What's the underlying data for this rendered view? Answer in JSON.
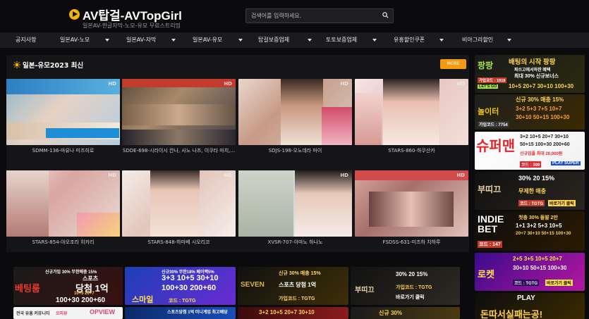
{
  "header": {
    "logo_text": "AV탑걸-AVTopGirl",
    "tagline": "일본AV-한글자막-노모-유모 무료스트리밍",
    "search_placeholder": "검색어를 입력하세요."
  },
  "nav": {
    "items": [
      "공지사항",
      "일본AV-노모",
      "일본AV-자막",
      "일본AV-유모",
      "탑걸보증업체",
      "토토보증업체",
      "유흥할인쿠폰",
      "비아그라할인"
    ]
  },
  "section": {
    "title": "일본-유모2023 최신",
    "more_label": "MORE"
  },
  "videos": [
    {
      "caption": "SDMM-136-마유나 미즈히로",
      "hd": "HD"
    },
    {
      "caption": "SDDE-698-시라이시 칸나, 사노 나츠, 이쿠타 마치,...",
      "hd": "HD"
    },
    {
      "caption": "SDJS-198-오노데라 마이",
      "hd": "HD"
    },
    {
      "caption": "STARS-860-하쿠산카",
      "hd": "HD"
    },
    {
      "caption": "STARS-854-야오조라 히카리",
      "hd": "HD"
    },
    {
      "caption": "STARS-848-하마베 시오리코",
      "hd": "HD"
    },
    {
      "caption": "XVSR-707-아마노 하나노",
      "hd": "HD"
    },
    {
      "caption": "FSDSS-631-미즈하 치하루",
      "hd": "HD"
    }
  ],
  "bottom_ads": [
    {
      "line1": "신규가입 30% 무한매충 15%",
      "line2": "스포츠",
      "line3": "당첨 1억",
      "line4": "10+5 20+7",
      "line5": "100+30 200+60",
      "brand": "베팅룸"
    },
    {
      "line1": "신규30% 무한18% 페이백5%",
      "line2": "3+3 10+5 30+10",
      "line3": "100+30 200+60",
      "line4": "코드 : TGTG",
      "brand": "스마일"
    },
    {
      "line1": "신규 30% 매충 15%",
      "line2": "스포츠 당첨 1억",
      "line3": "가입코드 : TGTG",
      "brand": "SEVEN"
    },
    {
      "line1": "30% 20 15%",
      "line2": "가입코드 : TGTG",
      "line3": "바로가기 클릭",
      "brand": "부띠끄"
    },
    {
      "line1": "전국 유흥 커뮤니티",
      "line2": "오피뷰",
      "brand": "OPVIEW"
    },
    {
      "line1": "스포츠당첨 1억 미니게임 최고배당",
      "brand": ""
    },
    {
      "line1": "3+2 10+5 20+7 30+10",
      "brand": ""
    },
    {
      "line1": "신규 30%",
      "brand": ""
    }
  ],
  "side_ads": [
    {
      "top": "배팅의 시작 팡팡",
      "mid": "파쓰고에서하한 혜택",
      "line": "최대 30% 신규보너스",
      "line2": "10+5 20+7 30+10 100+30",
      "code": "가입코드 : 1919",
      "brand": "팡팡",
      "go": "LET'S GO"
    },
    {
      "top": "신규 30% 매충 15%",
      "line": "3+2 5+3 7+5 10+7",
      "line2": "30+10 50+15 100+30",
      "code": "가입코드 : 7754",
      "brand": "놀이터"
    },
    {
      "top": "3+2 10+5 20+7 30+10",
      "line": "50+15 100+30 200+60",
      "line2": "신규입플 최대 20,000원",
      "code": "코드 : 399",
      "brand": "슈퍼맨",
      "go": "PLAY SUPER"
    },
    {
      "top": "30% 20 15%",
      "line": "무제한 매충",
      "code": "코드 : TGTG",
      "brand": "부띠끄",
      "go": "바로가기 클릭"
    },
    {
      "top": "첫충 30% 돌발 2만",
      "line": "1+1 3+2 5+3 10+5",
      "line2": "20+7 30+10 50+15 100+30",
      "code": "코드 : 147",
      "brand": "INDIE BET"
    },
    {
      "top": "2+5 3+5 10+5 20+7",
      "line": "30+10 50+15 100+30",
      "code": "코드 : TGTG",
      "brand": "로켓",
      "go": "바로가기 클릭"
    },
    {
      "top": "PLAY",
      "line": "돈따서실패는공!",
      "brand": "PLAY"
    }
  ],
  "colors": {
    "accent": "#f5b400",
    "more_button": "#f39c12",
    "nav_bg": "#1b1b1f",
    "panel_bg": "#151518"
  }
}
